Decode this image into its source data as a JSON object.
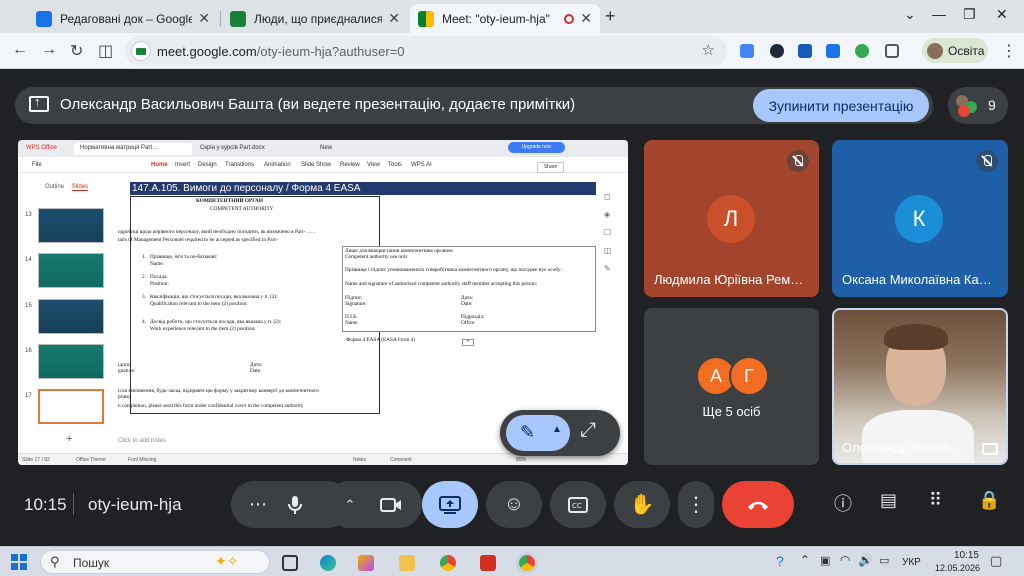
{
  "browser": {
    "tabs": [
      {
        "label": "Редаговані док – Google Диск",
        "color": "#4285f4"
      },
      {
        "label": "Люди, що приєдналися до ку…",
        "color": "#188038"
      },
      {
        "label": "Meet: \"oty-ieum-hja\"",
        "color": "#00832d"
      }
    ],
    "new_tab": "+",
    "url_host": "meet.google.com",
    "url_path": "/oty-ieum-hja?authuser=0",
    "profile_label": "Освіта"
  },
  "meet": {
    "banner_text": "Олександр Васильович Башта (ви ведете презентацію, додаєте примітки)",
    "stop_button": "Зупинити презентацію",
    "participant_count": "9",
    "tiles": [
      {
        "initial": "Л",
        "name": "Людмила Юріївна Рем…",
        "bg": "#a3452d",
        "avatar": "#c9502a"
      },
      {
        "initial": "К",
        "name": "Оксана Миколаївна Ка…",
        "bg": "#1e5fa8",
        "avatar": "#1a8fd8"
      }
    ],
    "others": {
      "initials": [
        "А",
        "Г"
      ],
      "label": "Ще 5 осіб"
    },
    "self_name": "Олександр Васил…",
    "clock": "10:15",
    "meeting_code": "oty-ieum-hja"
  },
  "slide": {
    "wps_tabs": [
      "WPS Office",
      "Нормативна матриця Part…",
      "Скрін у курсів Part.docx",
      "New"
    ],
    "menu_items": [
      "File",
      "Home",
      "Insert",
      "Design",
      "Transitions",
      "Animation",
      "Slide Show",
      "Review",
      "View",
      "Tools",
      "WPS AI"
    ],
    "upgrade": "Upgrade now",
    "share": "Share",
    "side_tabs": {
      "outline": "Outline",
      "slides": "Slides"
    },
    "thumb_numbers": [
      "13",
      "14",
      "15",
      "16",
      "17"
    ],
    "title": "147.A.105. Вимоги до персоналу / Форма 4 EASA",
    "ca_title": "КОМПЕТЕНТНИЙ ОРГАН",
    "ca_sub": "COMPETENT AUTHORITY",
    "intro1": "одробиці щодо керівного персоналу, який необхідно погодити, як визначено в Part-……",
    "intro2": "tails of Management Personnel required to be accepted as specified in Part-",
    "items": [
      {
        "n": "1.",
        "uk": "Прізвище, ім'я та по-батькові:",
        "en": "Name:"
      },
      {
        "n": "2.",
        "uk": "Посада:",
        "en": "Position:"
      },
      {
        "n": "3.",
        "uk": "Кваліфікація, що стосується посади, яка вказана у п. (2):",
        "en": "Qualification relevant to the item (2) position:"
      },
      {
        "n": "4.",
        "uk": "Досвід роботи, що стосується посади, яка вказана у п. (2):",
        "en": "Work experience relevant to the item (2) position:"
      }
    ],
    "rb_line1": "Лише для використання компетентним органом",
    "rb_line2": "Competent authority use only",
    "rb_line3": "Прізвище і підпис уповноваженого співробітника компетентного органу, що погодже нує особу:",
    "rb_line4": "Name and signature of authorised competent authority staff member accepting this person:",
    "rb_sig_uk": "Підпис:",
    "rb_sig_en": "Signature:",
    "rb_date_uk": "Дата:",
    "rb_date_en": "Date:",
    "rb_pib": "П.І.Б.",
    "rb_name": "Name",
    "rb_unit_uk": "Підрозділ:",
    "rb_unit_en": "Office",
    "form_caption": "Форма 4 EASA (EASA Form 4)",
    "sign_uk": "ідпис:",
    "sign_en": "gnature:",
    "date_uk": "Дата:",
    "date_en": "Date:",
    "footer1": "ісля заповнення, будь-ласка, відправте цю форму у закритому конверті до компетентного",
    "footer1b": "ргану",
    "footer2": "n completion, please send this form under confidential cover to the competent authority",
    "notes_hint": "Click to add notes",
    "status_slide": "Slide 17 / 82",
    "status_theme": "Office Theme",
    "status_font": "Font Missing",
    "status_notes": "Notes",
    "status_comment": "Comment",
    "status_zoom": "80%"
  },
  "taskbar": {
    "search_label": "Пошук",
    "lang": "УКР",
    "time": "10:15",
    "date": "12.05.2026"
  }
}
